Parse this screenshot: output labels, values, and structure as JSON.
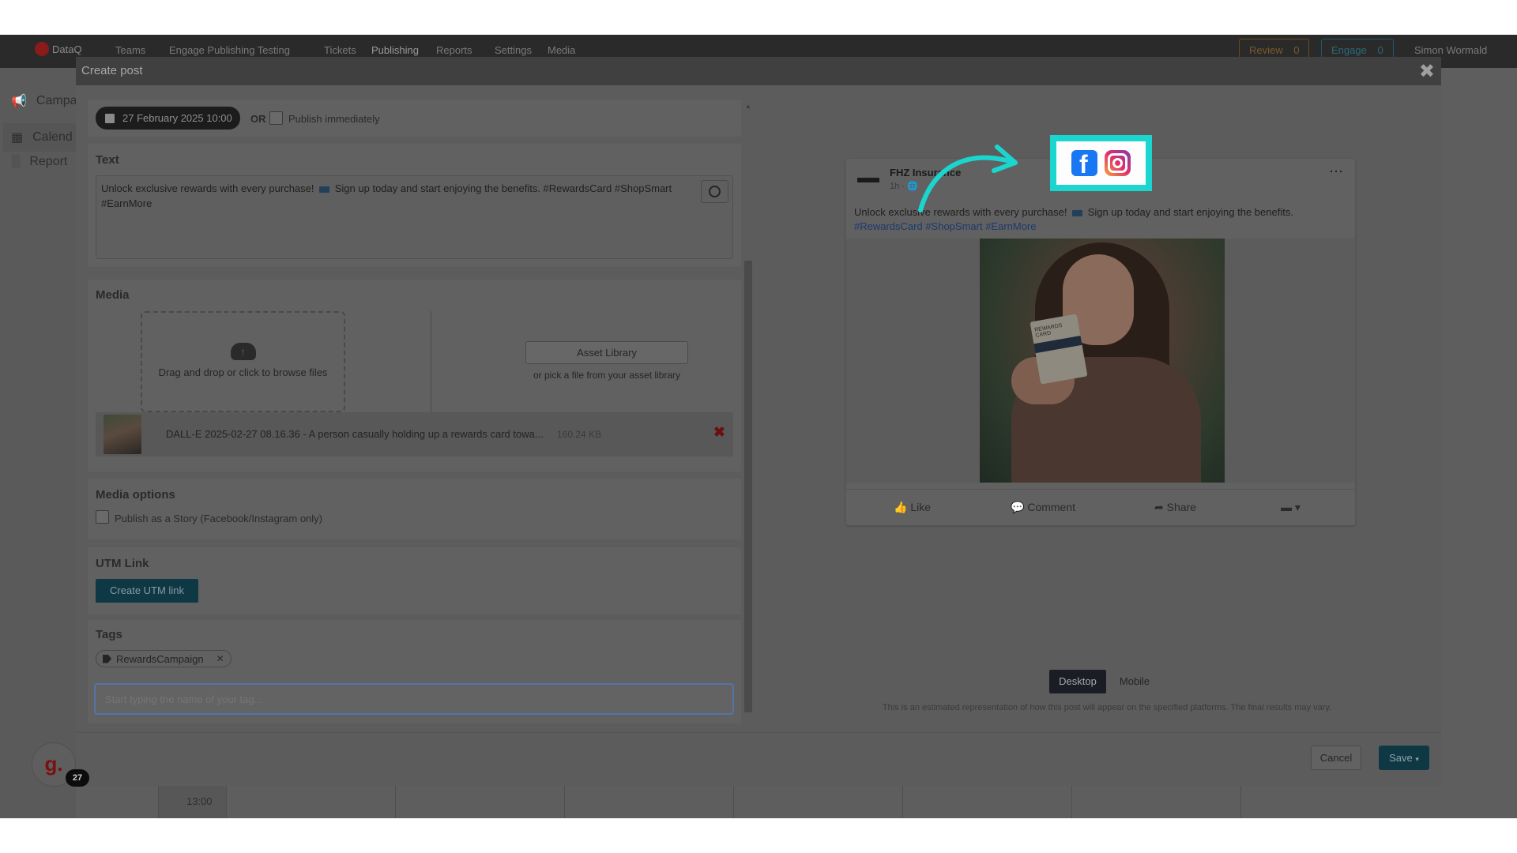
{
  "nav": {
    "logo": "DataQ",
    "items": [
      "Teams",
      "Engage Publishing Testing",
      "Tickets",
      "Publishing",
      "Reports",
      "Settings",
      "Media"
    ],
    "review_label": "Review",
    "review_count": "0",
    "engage_label": "Engage",
    "engage_count": "0",
    "user": "Simon Wormald"
  },
  "sidebar": {
    "items": [
      {
        "label": "Campa",
        "icon": "megaphone-icon"
      },
      {
        "label": "Calend",
        "icon": "calendar-icon"
      },
      {
        "label": "Report",
        "icon": "bar-chart-icon"
      }
    ]
  },
  "calendar": {
    "time_label": "13:00"
  },
  "modal": {
    "title": "Create post",
    "schedule": {
      "date": "27 February 2025 10:00",
      "or": "OR",
      "publish_immediately": "Publish immediately"
    },
    "text_section": {
      "heading": "Text",
      "line1a": "Unlock exclusive rewards with every purchase!",
      "line1b": "Sign up today and start enjoying the benefits. #RewardsCard #ShopSmart",
      "line2": "#EarnMore"
    },
    "media": {
      "heading": "Media",
      "dropzone": "Drag and drop or click to browse files",
      "asset_library": "Asset Library",
      "asset_sub": "or pick a file from your asset library",
      "file": {
        "name": "DALL-E 2025-02-27 08.16.36 - A person casually holding up a rewards card towa...",
        "size": "160.24 KB"
      }
    },
    "media_options": {
      "heading": "Media options",
      "story_label": "Publish as a Story (Facebook/Instagram only)"
    },
    "utm": {
      "heading": "UTM Link",
      "button": "Create UTM link"
    },
    "tags": {
      "heading": "Tags",
      "chip": "RewardsCampaign",
      "placeholder": "Start typing the name of your tag..."
    },
    "preview": {
      "page_name": "FHZ Insurance",
      "time": "1h ·",
      "text_a": "Unlock exclusive rewards with every purchase!",
      "text_b": "Sign up today and start enjoying the benefits.",
      "hashtags": "#RewardsCard #ShopSmart #EarnMore",
      "card_text": "REWARDS CARD",
      "like": "Like",
      "comment": "Comment",
      "share": "Share",
      "toggle_desktop": "Desktop",
      "toggle_mobile": "Mobile",
      "disclaimer": "This is an estimated representation of how this post will appear on the specified platforms. The final results may vary."
    },
    "footer": {
      "cancel": "Cancel",
      "save": "Save"
    }
  },
  "annotation": {
    "highlight_color": "#1ad6cf",
    "icons": [
      "facebook-icon",
      "instagram-icon"
    ]
  },
  "help": {
    "letter": "g.",
    "badge": "27"
  }
}
